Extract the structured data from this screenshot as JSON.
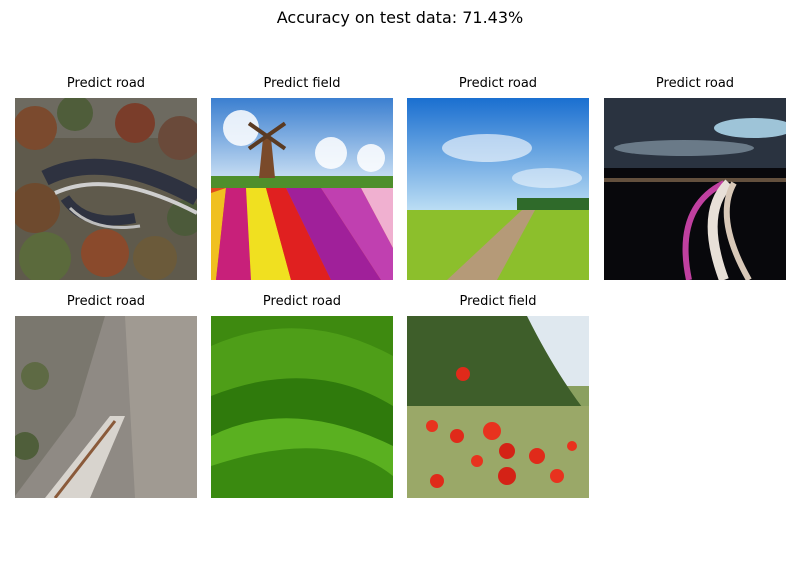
{
  "chart_data": {
    "type": "image-grid",
    "title": "Accuracy on test data: 71.43%",
    "panels": [
      {
        "title": "Predict road",
        "image": "aerial-winding-road-forest"
      },
      {
        "title": "Predict field",
        "image": "windmill-tulip-field"
      },
      {
        "title": "Predict road",
        "image": "dirt-road-green-field-blue-sky"
      },
      {
        "title": "Predict road",
        "image": "night-highway-light-trails"
      },
      {
        "title": "Predict road",
        "image": "cliff-side-road"
      },
      {
        "title": "Predict road",
        "image": "rolling-green-hills"
      },
      {
        "title": "Predict field",
        "image": "red-poppy-field"
      }
    ]
  }
}
